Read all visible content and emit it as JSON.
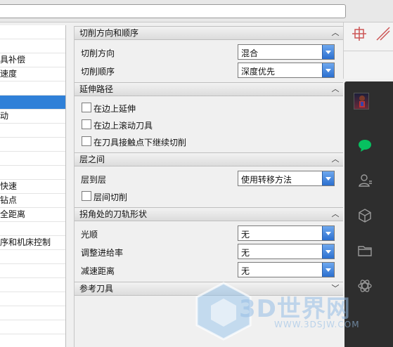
{
  "left_list": {
    "items": [
      {
        "label": ""
      },
      {
        "label": ""
      },
      {
        "label": "具补偿"
      },
      {
        "label": "速度"
      },
      {
        "label": ""
      },
      {
        "label": "",
        "selected": true
      },
      {
        "label": "动"
      },
      {
        "label": ""
      },
      {
        "label": ""
      },
      {
        "label": ""
      },
      {
        "label": ""
      },
      {
        "label": "快速"
      },
      {
        "label": "钻点"
      },
      {
        "label": "全距离"
      },
      {
        "label": ""
      },
      {
        "label": "序和机床控制"
      },
      {
        "label": ""
      },
      {
        "label": ""
      },
      {
        "label": ""
      },
      {
        "label": ""
      },
      {
        "label": ""
      },
      {
        "label": ""
      }
    ]
  },
  "sections": {
    "cut_direction": {
      "title": "切削方向和顺序",
      "direction_label": "切削方向",
      "direction_value": "混合",
      "order_label": "切削顺序",
      "order_value": "深度优先"
    },
    "extend_path": {
      "title": "延伸路径",
      "opt1": "在边上延伸",
      "opt2": "在边上滚动刀具",
      "opt3": "在刀具接触点下继续切削"
    },
    "between_levels": {
      "title": "层之间",
      "level_label": "层到层",
      "level_value": "使用转移方法",
      "interlevel_cut": "层间切削"
    },
    "corner_shape": {
      "title": "拐角处的刀轨形状",
      "smooth_label": "光顺",
      "smooth_value": "无",
      "feed_label": "调整进给率",
      "feed_value": "无",
      "slowdown_label": "减速距离",
      "slowdown_value": "无"
    },
    "ref_tool": {
      "title": "参考刀具"
    }
  },
  "watermark": {
    "text": "3D世界网",
    "url": "WWW.3DSJW.COM"
  },
  "colors": {
    "selection": "#2f80d8",
    "combo_button": "#2b6fcf",
    "chat_green": "#07c160"
  }
}
